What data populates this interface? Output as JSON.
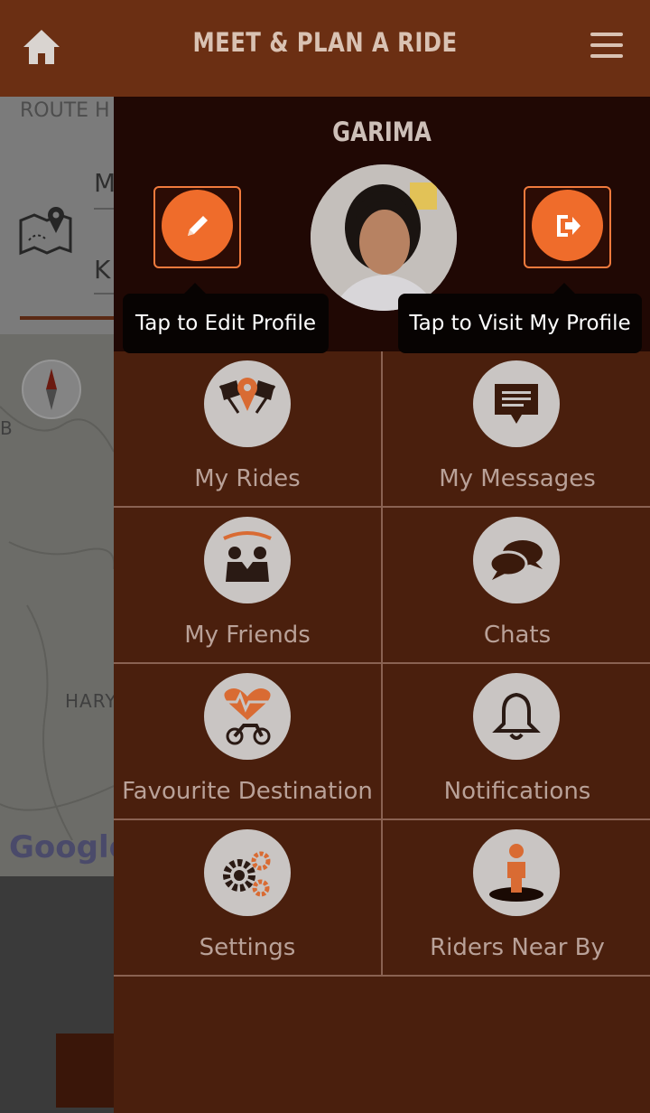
{
  "header": {
    "title": "MEET & PLAN A RIDE",
    "home_icon": "home-icon",
    "menu_icon": "hamburger-menu-icon"
  },
  "background": {
    "route_label": "ROUTE H",
    "field_1": "M",
    "field_2": "K",
    "map_label_b": "B",
    "map_label_state": "HARY",
    "google_logo": "Google"
  },
  "drawer": {
    "username": "GARIMA",
    "edit_tooltip": "Tap to Edit Profile",
    "visit_tooltip": "Tap to Visit My Profile",
    "accent_color": "#ef6c2b",
    "items": [
      {
        "label": "My Rides",
        "icon": "rides-flags-icon"
      },
      {
        "label": "My Messages",
        "icon": "message-icon"
      },
      {
        "label": "My Friends",
        "icon": "friends-icon"
      },
      {
        "label": "Chats",
        "icon": "chat-bubbles-icon"
      },
      {
        "label": "Favourite Destination",
        "icon": "heart-bike-icon"
      },
      {
        "label": "Notifications",
        "icon": "bell-icon"
      },
      {
        "label": "Settings",
        "icon": "gears-icon"
      },
      {
        "label": "Riders Near By",
        "icon": "rider-location-icon"
      }
    ]
  }
}
